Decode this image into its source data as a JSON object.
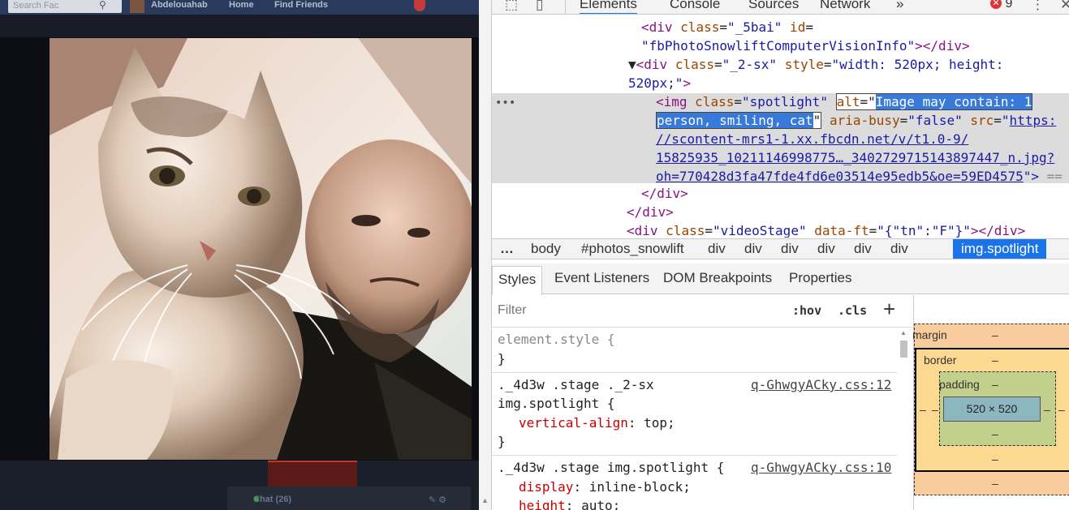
{
  "facebook": {
    "search_placeholder": "Search Fac",
    "user_name": "Abdelouahab",
    "nav_home": "Home",
    "nav_find_friends": "Find Friends",
    "chat_label": "Chat (26)"
  },
  "devtools": {
    "tabs": [
      "Elements",
      "Console",
      "Sources",
      "Network"
    ],
    "active_tab": "Elements",
    "more_tabs_icon": "double-chevron-right-icon",
    "error_count": "9",
    "dom": {
      "line1_tag_open": "<div ",
      "line1_attr1": "class",
      "line1_val1": "\"_5bai\"",
      "line1_attr2": " id",
      "line1_eq": "=",
      "line2_val": "\"fbPhotoSnowliftComputerVisionInfo\"",
      "line2_close": "></div>",
      "line3_arrow": "▼",
      "line3_tag": "<div ",
      "line3_attr1": "class",
      "line3_val1": "\"_2-sx\"",
      "line3_attr2": " style",
      "line3_val2_a": "\"width: 520px; height:",
      "line4_val2_b": "520px;\"",
      "line4_close": ">",
      "line5_tag": "<img ",
      "line5_attr1": "class",
      "line5_val1": "\"spotlight\"",
      "line5_attr2": "alt",
      "line5_eq": "=\"",
      "alt_text_1": "Image may contain: 1",
      "alt_text_2": "person, smiling, cat",
      "line6_quote": "\"",
      "line6_attr3": "aria-busy",
      "line6_val3": "\"false\"",
      "line6_attr4": "src",
      "line6_val4_start": "\"",
      "src_1": "https:",
      "src_2": "//scontent-mrs1-1.xx.fbcdn.net/v/t1.0-9/",
      "src_3": "15825935_10211146998775…_3402729715143897447_n.jpg?",
      "src_4": "oh=770428d3fa47fde4fd6e03514e95edb5&oe=59ED4575",
      "line9_close": "\">",
      "line9_eq": " ==",
      "line10": "</div>",
      "line11": "</div>",
      "line12_tag": "<div ",
      "line12_attr": "class",
      "line12_val": "\"videoStage\"",
      "line12_attr2": " data-ft",
      "line12_val2": "\"{\"tn\":\"F\"}\"",
      "line12_close": "></div>"
    },
    "breadcrumbs": [
      "…",
      "body",
      "#photos_snowlift",
      "div",
      "div",
      "div",
      "div",
      "div",
      "div",
      "img.spotlight"
    ],
    "subtabs": [
      "Styles",
      "Event Listeners",
      "DOM Breakpoints",
      "Properties"
    ],
    "filter_placeholder": "Filter",
    "hov_label": ":hov",
    "cls_label": ".cls",
    "plus_label": "+",
    "rules": {
      "r1_sel": "element.style {",
      "r1_close": "}",
      "r2_sel_a": "._4d3w .stage ._2-sx",
      "r2_src": "q-GhwgyACky.css:12",
      "r2_sel_b": "img.spotlight {",
      "r2_prop": "vertical-align",
      "r2_val": ": top;",
      "r2_close": "}",
      "r3_sel": "._4d3w .stage img.spotlight {",
      "r3_src": "q-GhwgyACky.css:10",
      "r3_prop1": "display",
      "r3_val1": ": inline-block;",
      "r3_prop2": "height",
      "r3_val2": ": auto;"
    },
    "box_model": {
      "margin_label": "margin",
      "border_label": "border",
      "padding_label": "padding",
      "dash": "–",
      "content_size": "520 × 520"
    }
  }
}
